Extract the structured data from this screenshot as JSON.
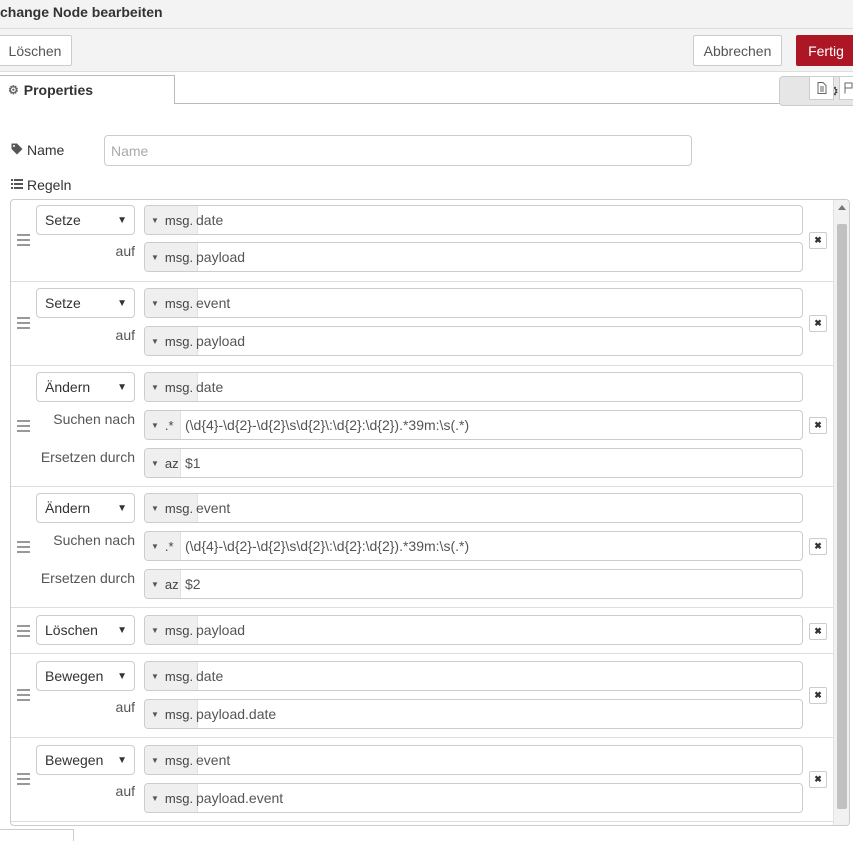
{
  "header": {
    "title": "change Node bearbeiten"
  },
  "toolbar": {
    "delete": "Löschen",
    "cancel": "Abbrechen",
    "done": "Fertig"
  },
  "tabs": {
    "properties": "Properties"
  },
  "form": {
    "name_label": "Name",
    "name_placeholder": "Name",
    "name_value": "",
    "rules_label": "Regeln"
  },
  "rules": [
    {
      "action": "Setze",
      "rows": [
        {
          "label": "",
          "type": "msg.",
          "value": "date"
        },
        {
          "label": "auf",
          "type": "msg.",
          "value": "payload"
        }
      ]
    },
    {
      "action": "Setze",
      "rows": [
        {
          "label": "",
          "type": "msg.",
          "value": "event"
        },
        {
          "label": "auf",
          "type": "msg.",
          "value": "payload"
        }
      ]
    },
    {
      "action": "Ändern",
      "rows": [
        {
          "label": "",
          "type": "msg.",
          "value": "date"
        },
        {
          "label": "Suchen nach",
          "type": ".*",
          "value": "(\\d{4}-\\d{2}-\\d{2}\\s\\d{2}\\:\\d{2}:\\d{2}).*39m:\\s(.*)"
        },
        {
          "label": "Ersetzen durch",
          "type": "az",
          "value": "$1"
        }
      ]
    },
    {
      "action": "Ändern",
      "rows": [
        {
          "label": "",
          "type": "msg.",
          "value": "event"
        },
        {
          "label": "Suchen nach",
          "type": ".*",
          "value": "(\\d{4}-\\d{2}-\\d{2}\\s\\d{2}\\:\\d{2}:\\d{2}).*39m:\\s(.*)"
        },
        {
          "label": "Ersetzen durch",
          "type": "az",
          "value": "$2"
        }
      ]
    },
    {
      "action": "Löschen",
      "rows": [
        {
          "label": "",
          "type": "msg.",
          "value": "payload"
        }
      ]
    },
    {
      "action": "Bewegen",
      "rows": [
        {
          "label": "",
          "type": "msg.",
          "value": "date"
        },
        {
          "label": "auf",
          "type": "msg.",
          "value": "payload.date"
        }
      ]
    },
    {
      "action": "Bewegen",
      "rows": [
        {
          "label": "",
          "type": "msg.",
          "value": "event"
        },
        {
          "label": "auf",
          "type": "msg.",
          "value": "payload.event"
        }
      ]
    }
  ],
  "colors": {
    "primary_button": "#ad1625",
    "panel_bg": "#f3f3f3"
  },
  "icons": {
    "tab": "gear-icon",
    "tab_buttons": [
      "gear-icon",
      "document-icon",
      "flag-icon"
    ],
    "name": "tag-icon",
    "rules": "list-icon",
    "remove": "close-icon"
  }
}
